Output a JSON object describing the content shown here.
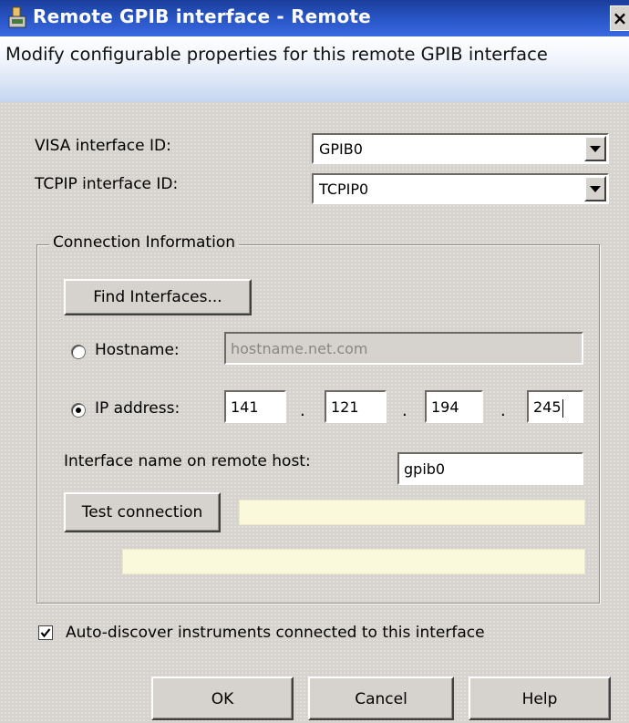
{
  "window": {
    "title": "Remote GPIB interface - Remote",
    "close_glyph": "×",
    "subtitle": "Modify configurable properties for this remote GPIB interface"
  },
  "visa": {
    "label": "VISA interface ID:",
    "value": "GPIB0"
  },
  "tcpip": {
    "label": "TCPIP interface ID:",
    "value": "TCPIP0"
  },
  "connection": {
    "group_title": "Connection Information",
    "find_button": "Find Interfaces...",
    "hostname_label": "Hostname:",
    "hostname_placeholder": "hostname.net.com",
    "hostname_selected": false,
    "ip_label": "IP address:",
    "ip_selected": true,
    "ip_octets": [
      "141",
      "121",
      "194",
      "245"
    ],
    "ip_separator": ".",
    "remote_name_label": "Interface name on remote host:",
    "remote_name_value": "gpib0",
    "test_button": "Test connection",
    "status_line1": "",
    "status_line2": ""
  },
  "auto_discover": {
    "label": "Auto-discover instruments connected to this interface",
    "checked": true
  },
  "buttons": {
    "ok": "OK",
    "cancel": "Cancel",
    "help": "Help"
  },
  "icons": [
    "app-icon",
    "close-icon",
    "dropdown-arrow-icon",
    "checkmark-icon"
  ]
}
